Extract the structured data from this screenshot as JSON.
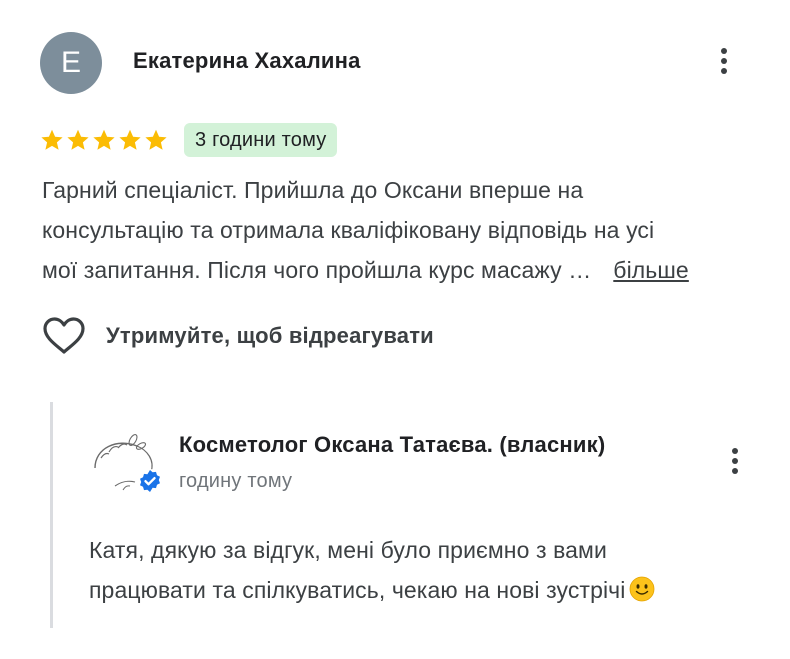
{
  "review": {
    "avatar_letter": "E",
    "avatar_color": "#7d8e9b",
    "author": "Екатерина Хахалина",
    "rating": 5,
    "max_rating": 5,
    "time_badge": "3 години тому",
    "text_lines": [
      "Гарний спеціаліст. Прийшла до Оксани вперше на",
      "консультацію та отримала кваліфіковану відповідь на усі",
      "мої запитання. Після чого пройшла курс масажу …"
    ],
    "more_label": "більше",
    "react_label": "Утримуйте, щоб відреагувати",
    "menu_icon": "more-vert-icon"
  },
  "owner_reply": {
    "name": "Косметолог Оксана Татаєва. (власник)",
    "time": "годину тому",
    "text_lines": [
      "Катя, дякую за відгук, мені було приємно з вами",
      "працювати та спілкуватись, чекаю на нові зустрічі"
    ],
    "emoji_icon": "slightly-smiling-face-icon",
    "verified_icon": "verified-badge-icon",
    "menu_icon": "more-vert-icon"
  },
  "colors": {
    "star": "#fbbc04",
    "badge_bg": "#d3f2d8",
    "verified": "#1a73e8",
    "divider": "#dadce0"
  }
}
